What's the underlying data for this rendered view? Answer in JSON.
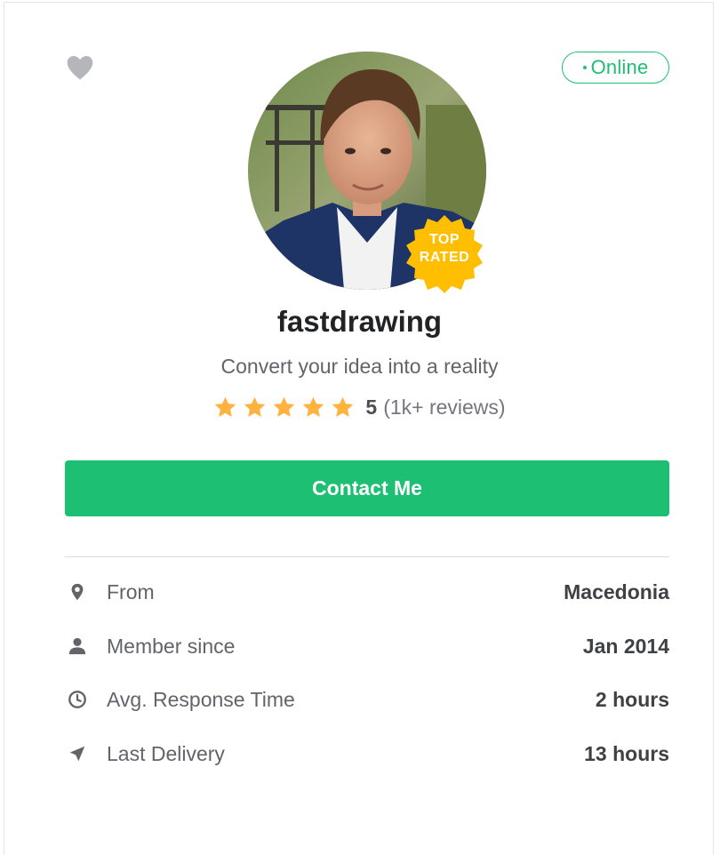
{
  "profile": {
    "favorite_icon": "heart-icon",
    "status": "Online",
    "avatar_alt": "fastdrawing",
    "badge": {
      "line1": "TOP",
      "line2": "RATED",
      "color": "#ffbe00"
    },
    "username": "fastdrawing",
    "tagline": "Convert your idea into a reality",
    "rating": {
      "stars": 5,
      "score": "5",
      "reviews": "(1k+ reviews)",
      "star_color": "#ffb33e"
    }
  },
  "contact_button": {
    "label": "Contact Me",
    "color": "#1dbf73"
  },
  "stats": [
    {
      "icon": "location-pin-icon",
      "label": "From",
      "value": "Macedonia"
    },
    {
      "icon": "user-icon",
      "label": "Member since",
      "value": "Jan 2014"
    },
    {
      "icon": "clock-icon",
      "label": "Avg. Response Time",
      "value": "2 hours"
    },
    {
      "icon": "paper-plane-icon",
      "label": "Last Delivery",
      "value": "13 hours"
    }
  ]
}
